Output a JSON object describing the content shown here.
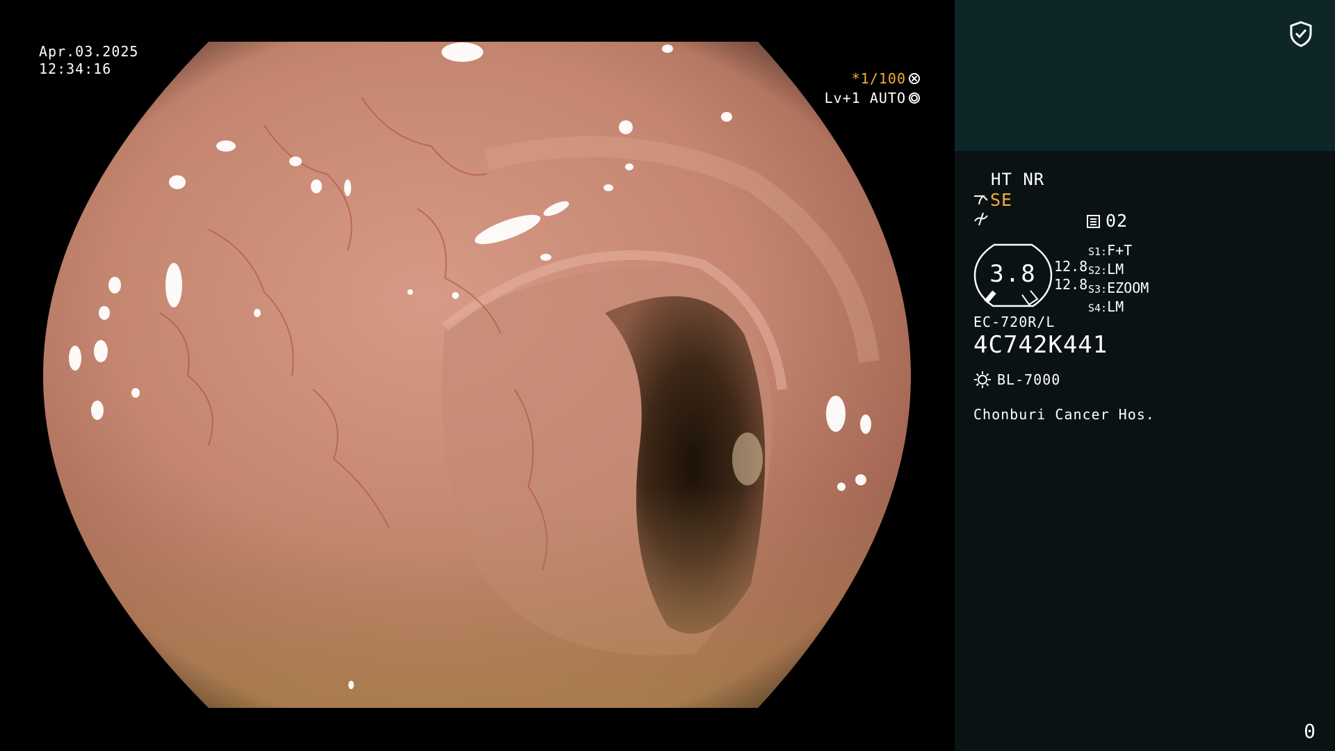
{
  "overlay": {
    "date": "Apr.03.2025",
    "time": "12:34:16",
    "shutter": "*1/100",
    "level": "Lv+1 AUTO"
  },
  "panel": {
    "ht_nr": "HT NR",
    "se_label": "SE",
    "memo_value": "02",
    "dial_value": "3.8",
    "dial_upper": "12.8",
    "dial_lower": "12.8",
    "switches": [
      {
        "key": "S1:",
        "value": "F+T"
      },
      {
        "key": "S2:",
        "value": "LM"
      },
      {
        "key": "S3:",
        "value": "EZOOM"
      },
      {
        "key": "S4:",
        "value": "LM"
      }
    ],
    "scope_model": "EC-720R/L",
    "serial": "4C742K441",
    "light_source": "BL-7000",
    "hospital": "Chonburi Cancer Hos.",
    "counter": "0"
  },
  "icons": {
    "shield": "shield-check-icon",
    "se": "scope-se-icon",
    "enhancement": "enhancement-icon",
    "memo": "memo-icon",
    "light": "light-source-icon",
    "shutter": "shutter-icon",
    "iris": "iris-icon"
  },
  "colors": {
    "panel_bg": "#0b1213",
    "panel_top_bg": "#0e2628",
    "amber": "#f2b03a",
    "text": "#ffffff"
  }
}
